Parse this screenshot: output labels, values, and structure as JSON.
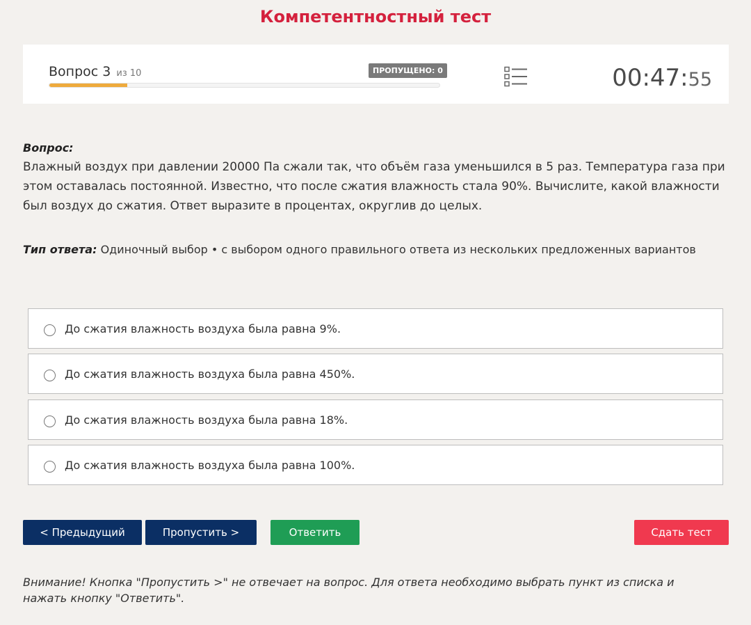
{
  "page": {
    "title": "Компетентностный тест"
  },
  "header": {
    "question_prefix": "Вопрос",
    "question_number": "3",
    "question_of": "из 10",
    "progress_fraction": 0.2,
    "skipped_label": "ПРОПУЩЕНО: 0",
    "list_icon": "question-list-icon",
    "timer_main": "00:47:",
    "timer_seconds": "55"
  },
  "question": {
    "label": "Вопрос:",
    "text": "Влажный воздух при давлении 20000 Па сжали так, что объём газа уменьшился в 5 раз. Температура газа при этом оставалась постоянной. Известно, что после сжатия влажность стала 90%. Вычислите, какой влажности был воздух до сжатия. Ответ выразите в процентах, округлив до целых.",
    "answer_type_label": "Тип ответа:",
    "answer_type_value": "Одиночный выбор • с выбором одного правильного ответа из нескольких предложенных вариантов"
  },
  "options": [
    {
      "text": "До сжатия влажность воздуха была равна 9%."
    },
    {
      "text": "До сжатия влажность воздуха была равна 450%."
    },
    {
      "text": "До сжатия влажность воздуха была равна 18%."
    },
    {
      "text": "До сжатия влажность воздуха была равна 100%."
    }
  ],
  "buttons": {
    "prev": "< Предыдущий",
    "skip": "Пропустить >",
    "answer": "Ответить",
    "finish": "Сдать тест"
  },
  "notice": "Внимание! Кнопка \"Пропустить >\" не отвечает на вопрос. Для ответа необходимо выбрать пункт из списка и нажать кнопку \"Ответить\".",
  "colors": {
    "title": "#d4213d",
    "progress": "#eeaa3c",
    "primary": "#0b2f64",
    "answer": "#1f9d55",
    "finish": "#f0394f"
  }
}
